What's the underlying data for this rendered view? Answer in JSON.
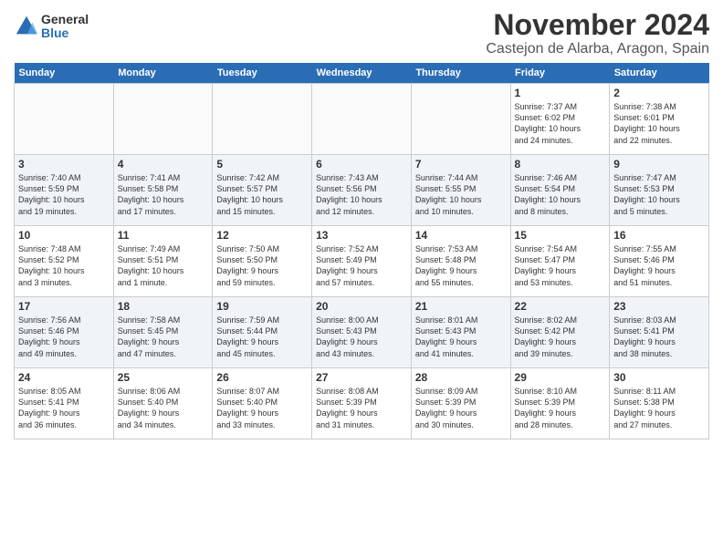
{
  "app": {
    "logo_general": "General",
    "logo_blue": "Blue"
  },
  "header": {
    "month": "November 2024",
    "location": "Castejon de Alarba, Aragon, Spain"
  },
  "weekdays": [
    "Sunday",
    "Monday",
    "Tuesday",
    "Wednesday",
    "Thursday",
    "Friday",
    "Saturday"
  ],
  "weeks": [
    [
      {
        "day": "",
        "info": ""
      },
      {
        "day": "",
        "info": ""
      },
      {
        "day": "",
        "info": ""
      },
      {
        "day": "",
        "info": ""
      },
      {
        "day": "",
        "info": ""
      },
      {
        "day": "1",
        "info": "Sunrise: 7:37 AM\nSunset: 6:02 PM\nDaylight: 10 hours\nand 24 minutes."
      },
      {
        "day": "2",
        "info": "Sunrise: 7:38 AM\nSunset: 6:01 PM\nDaylight: 10 hours\nand 22 minutes."
      }
    ],
    [
      {
        "day": "3",
        "info": "Sunrise: 7:40 AM\nSunset: 5:59 PM\nDaylight: 10 hours\nand 19 minutes."
      },
      {
        "day": "4",
        "info": "Sunrise: 7:41 AM\nSunset: 5:58 PM\nDaylight: 10 hours\nand 17 minutes."
      },
      {
        "day": "5",
        "info": "Sunrise: 7:42 AM\nSunset: 5:57 PM\nDaylight: 10 hours\nand 15 minutes."
      },
      {
        "day": "6",
        "info": "Sunrise: 7:43 AM\nSunset: 5:56 PM\nDaylight: 10 hours\nand 12 minutes."
      },
      {
        "day": "7",
        "info": "Sunrise: 7:44 AM\nSunset: 5:55 PM\nDaylight: 10 hours\nand 10 minutes."
      },
      {
        "day": "8",
        "info": "Sunrise: 7:46 AM\nSunset: 5:54 PM\nDaylight: 10 hours\nand 8 minutes."
      },
      {
        "day": "9",
        "info": "Sunrise: 7:47 AM\nSunset: 5:53 PM\nDaylight: 10 hours\nand 5 minutes."
      }
    ],
    [
      {
        "day": "10",
        "info": "Sunrise: 7:48 AM\nSunset: 5:52 PM\nDaylight: 10 hours\nand 3 minutes."
      },
      {
        "day": "11",
        "info": "Sunrise: 7:49 AM\nSunset: 5:51 PM\nDaylight: 10 hours\nand 1 minute."
      },
      {
        "day": "12",
        "info": "Sunrise: 7:50 AM\nSunset: 5:50 PM\nDaylight: 9 hours\nand 59 minutes."
      },
      {
        "day": "13",
        "info": "Sunrise: 7:52 AM\nSunset: 5:49 PM\nDaylight: 9 hours\nand 57 minutes."
      },
      {
        "day": "14",
        "info": "Sunrise: 7:53 AM\nSunset: 5:48 PM\nDaylight: 9 hours\nand 55 minutes."
      },
      {
        "day": "15",
        "info": "Sunrise: 7:54 AM\nSunset: 5:47 PM\nDaylight: 9 hours\nand 53 minutes."
      },
      {
        "day": "16",
        "info": "Sunrise: 7:55 AM\nSunset: 5:46 PM\nDaylight: 9 hours\nand 51 minutes."
      }
    ],
    [
      {
        "day": "17",
        "info": "Sunrise: 7:56 AM\nSunset: 5:46 PM\nDaylight: 9 hours\nand 49 minutes."
      },
      {
        "day": "18",
        "info": "Sunrise: 7:58 AM\nSunset: 5:45 PM\nDaylight: 9 hours\nand 47 minutes."
      },
      {
        "day": "19",
        "info": "Sunrise: 7:59 AM\nSunset: 5:44 PM\nDaylight: 9 hours\nand 45 minutes."
      },
      {
        "day": "20",
        "info": "Sunrise: 8:00 AM\nSunset: 5:43 PM\nDaylight: 9 hours\nand 43 minutes."
      },
      {
        "day": "21",
        "info": "Sunrise: 8:01 AM\nSunset: 5:43 PM\nDaylight: 9 hours\nand 41 minutes."
      },
      {
        "day": "22",
        "info": "Sunrise: 8:02 AM\nSunset: 5:42 PM\nDaylight: 9 hours\nand 39 minutes."
      },
      {
        "day": "23",
        "info": "Sunrise: 8:03 AM\nSunset: 5:41 PM\nDaylight: 9 hours\nand 38 minutes."
      }
    ],
    [
      {
        "day": "24",
        "info": "Sunrise: 8:05 AM\nSunset: 5:41 PM\nDaylight: 9 hours\nand 36 minutes."
      },
      {
        "day": "25",
        "info": "Sunrise: 8:06 AM\nSunset: 5:40 PM\nDaylight: 9 hours\nand 34 minutes."
      },
      {
        "day": "26",
        "info": "Sunrise: 8:07 AM\nSunset: 5:40 PM\nDaylight: 9 hours\nand 33 minutes."
      },
      {
        "day": "27",
        "info": "Sunrise: 8:08 AM\nSunset: 5:39 PM\nDaylight: 9 hours\nand 31 minutes."
      },
      {
        "day": "28",
        "info": "Sunrise: 8:09 AM\nSunset: 5:39 PM\nDaylight: 9 hours\nand 30 minutes."
      },
      {
        "day": "29",
        "info": "Sunrise: 8:10 AM\nSunset: 5:39 PM\nDaylight: 9 hours\nand 28 minutes."
      },
      {
        "day": "30",
        "info": "Sunrise: 8:11 AM\nSunset: 5:38 PM\nDaylight: 9 hours\nand 27 minutes."
      }
    ]
  ]
}
